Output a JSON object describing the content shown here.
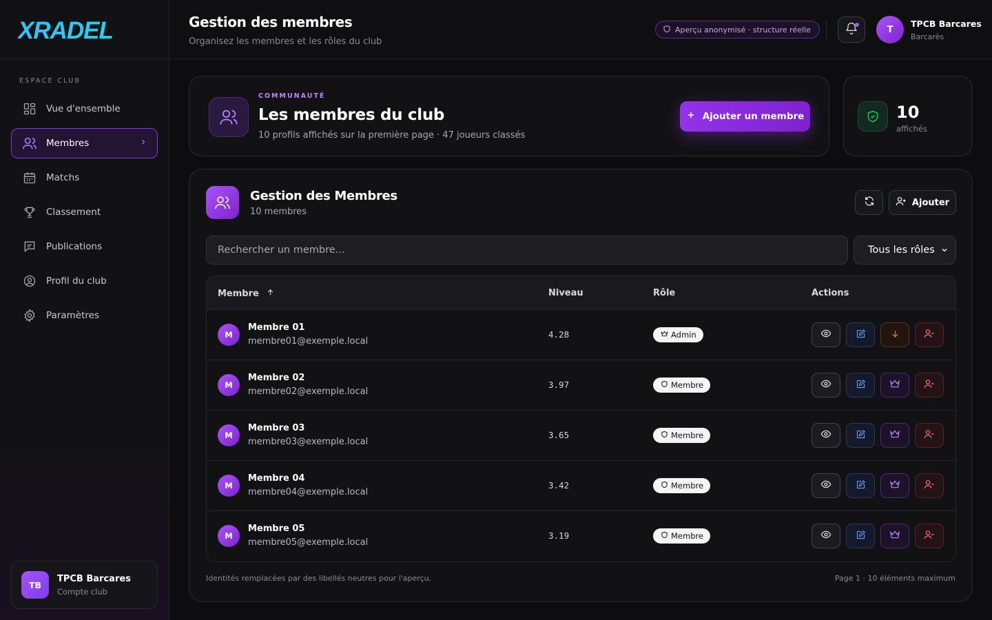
{
  "brand": {
    "logo_text": "XRADEL"
  },
  "sidebar": {
    "section_label": "ESPACE CLUB",
    "items": [
      {
        "label": "Vue d'ensemble",
        "icon": "grid-icon"
      },
      {
        "label": "Membres",
        "icon": "users-icon",
        "active": true
      },
      {
        "label": "Matchs",
        "icon": "calendar-icon"
      },
      {
        "label": "Classement",
        "icon": "trophy-icon"
      },
      {
        "label": "Publications",
        "icon": "message-icon"
      },
      {
        "label": "Profil du club",
        "icon": "user-circle-icon"
      },
      {
        "label": "Paramètres",
        "icon": "gear-icon"
      }
    ],
    "account": {
      "initials": "TB",
      "name": "TPCB Barcares",
      "subtitle": "Compte club"
    }
  },
  "header": {
    "title": "Gestion des membres",
    "subtitle": "Organisez les membres et les rôles du club",
    "preview_badge": "Aperçu anonymisé · structure réelle",
    "user": {
      "initial": "T",
      "name": "TPCB Barcares",
      "location": "Barcarès"
    }
  },
  "hero": {
    "eyebrow": "COMMUNAUTÉ",
    "title": "Les membres du club",
    "description": "10 profils affichés sur la première page · 47 joueurs classés",
    "add_button": "Ajouter un membre"
  },
  "stat": {
    "value": "10",
    "label": "affichés"
  },
  "members_panel": {
    "title": "Gestion des Membres",
    "count": "10 membres",
    "add_label": "Ajouter",
    "search_placeholder": "Rechercher un membre...",
    "role_filter": "Tous les rôles",
    "columns": {
      "member": "Membre",
      "level": "Niveau",
      "role": "Rôle",
      "actions": "Actions"
    },
    "rows": [
      {
        "initial": "M",
        "name": "Membre 01",
        "email": "membre01@exemple.local",
        "level": "4.28",
        "role": "Admin"
      },
      {
        "initial": "M",
        "name": "Membre 02",
        "email": "membre02@exemple.local",
        "level": "3.97",
        "role": "Membre"
      },
      {
        "initial": "M",
        "name": "Membre 03",
        "email": "membre03@exemple.local",
        "level": "3.65",
        "role": "Membre"
      },
      {
        "initial": "M",
        "name": "Membre 04",
        "email": "membre04@exemple.local",
        "level": "3.42",
        "role": "Membre"
      },
      {
        "initial": "M",
        "name": "Membre 05",
        "email": "membre05@exemple.local",
        "level": "3.19",
        "role": "Membre"
      }
    ],
    "footnote": "Identités remplacées par des libellés neutres pour l'aperçu.",
    "page_info": "Page 1 · 10 éléments maximum"
  },
  "colors": {
    "accent": "#9333ea",
    "success": "#22c55e",
    "danger": "#f87171",
    "info": "#60a5fa",
    "warning": "#f97316"
  }
}
